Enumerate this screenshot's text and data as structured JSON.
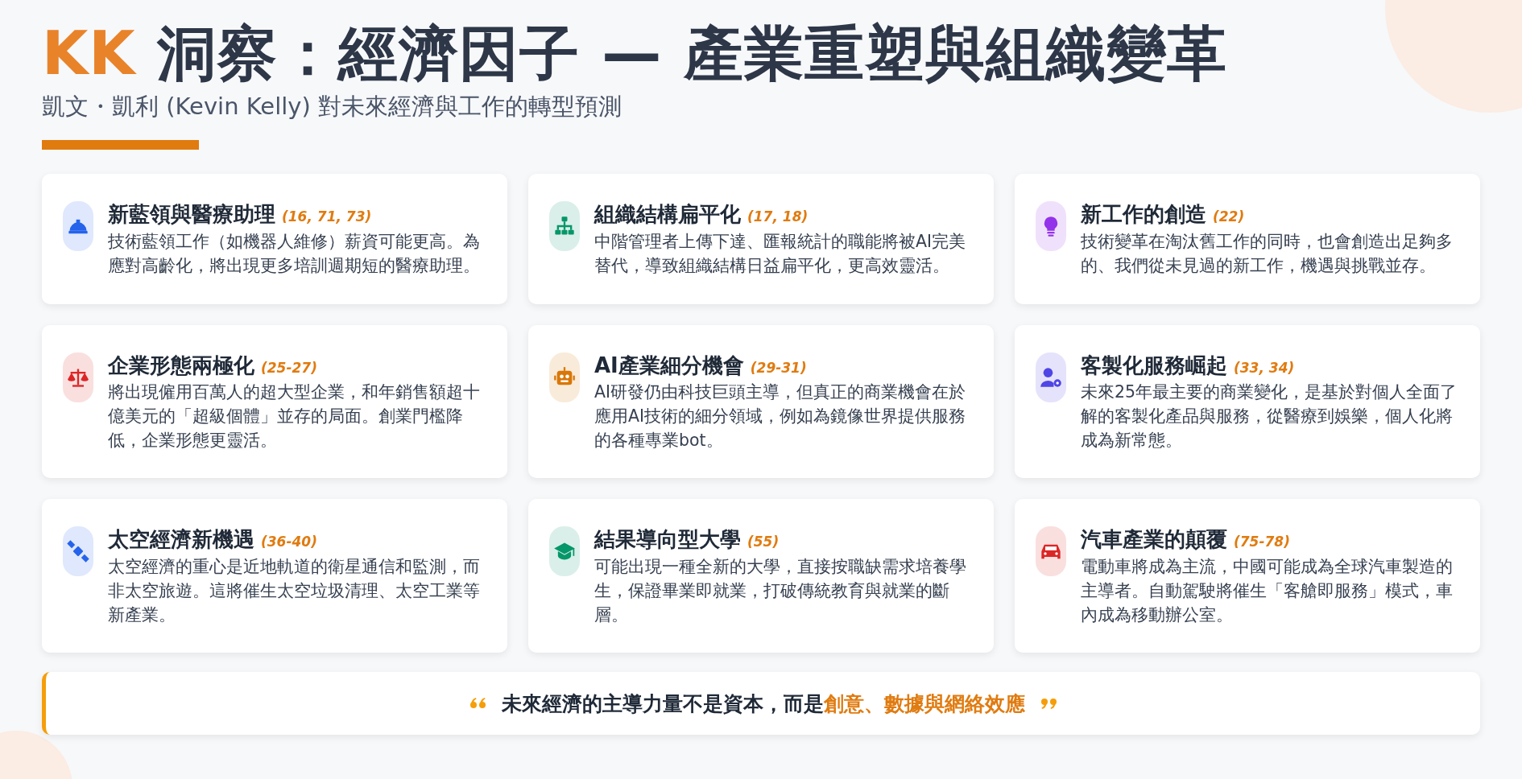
{
  "header": {
    "brand": "KK",
    "title": "洞察：經濟因子 — 產業重塑與組織變革",
    "subtitle": "凱文・凱利 (Kevin Kelly) 對未來經濟與工作的轉型預測"
  },
  "cards": [
    {
      "title": "新藍領與醫療助理",
      "pages": "(16, 71, 73)",
      "text": "技術藍領工作（如機器人維修）薪資可能更高。為應對高齡化，將出現更多培訓週期短的醫療助理。",
      "color": "#2563eb"
    },
    {
      "title": "組織結構扁平化",
      "pages": "(17, 18)",
      "text": "中階管理者上傳下達、匯報統計的職能將被AI完美替代，導致組織結構日益扁平化，更高效靈活。",
      "color": "#059669"
    },
    {
      "title": "新工作的創造",
      "pages": "(22)",
      "text": "技術變革在淘汰舊工作的同時，也會創造出足夠多的、我們從未見過的新工作，機遇與挑戰並存。",
      "color": "#9333ea"
    },
    {
      "title": "企業形態兩極化",
      "pages": "(25-27)",
      "text": "將出現僱用百萬人的超大型企業，和年銷售額超十億美元的「超級個體」並存的局面。創業門檻降低，企業形態更靈活。",
      "color": "#dc2626"
    },
    {
      "title": "AI產業細分機會",
      "pages": "(29-31)",
      "text": "AI研發仍由科技巨頭主導，但真正的商業機會在於應用AI技術的細分領域，例如為鏡像世界提供服務的各種專業bot。",
      "color": "#d97706"
    },
    {
      "title": "客製化服務崛起",
      "pages": "(33, 34)",
      "text": "未來25年最主要的商業變化，是基於對個人全面了解的客製化產品與服務，從醫療到娛樂，個人化將成為新常態。",
      "color": "#4f46e5"
    },
    {
      "title": "太空經濟新機遇",
      "pages": "(36-40)",
      "text": "太空經濟的重心是近地軌道的衛星通信和監測，而非太空旅遊。這將催生太空垃圾清理、太空工業等新產業。",
      "color": "#2563eb"
    },
    {
      "title": "結果導向型大學",
      "pages": "(55)",
      "text": "可能出現一種全新的大學，直接按職缺需求培養學生，保證畢業即就業，打破傳統教育與就業的斷層。",
      "color": "#059669"
    },
    {
      "title": "汽車產業的顛覆",
      "pages": "(75-78)",
      "text": "電動車將成為主流，中國可能成為全球汽車製造的主導者。自動駕駛將催生「客艙即服務」模式，車內成為移動辦公室。",
      "color": "#dc2626"
    }
  ],
  "quote": {
    "text": "未來經濟的主導力量不是資本，而是",
    "highlight": "創意、數據與網絡效應"
  }
}
